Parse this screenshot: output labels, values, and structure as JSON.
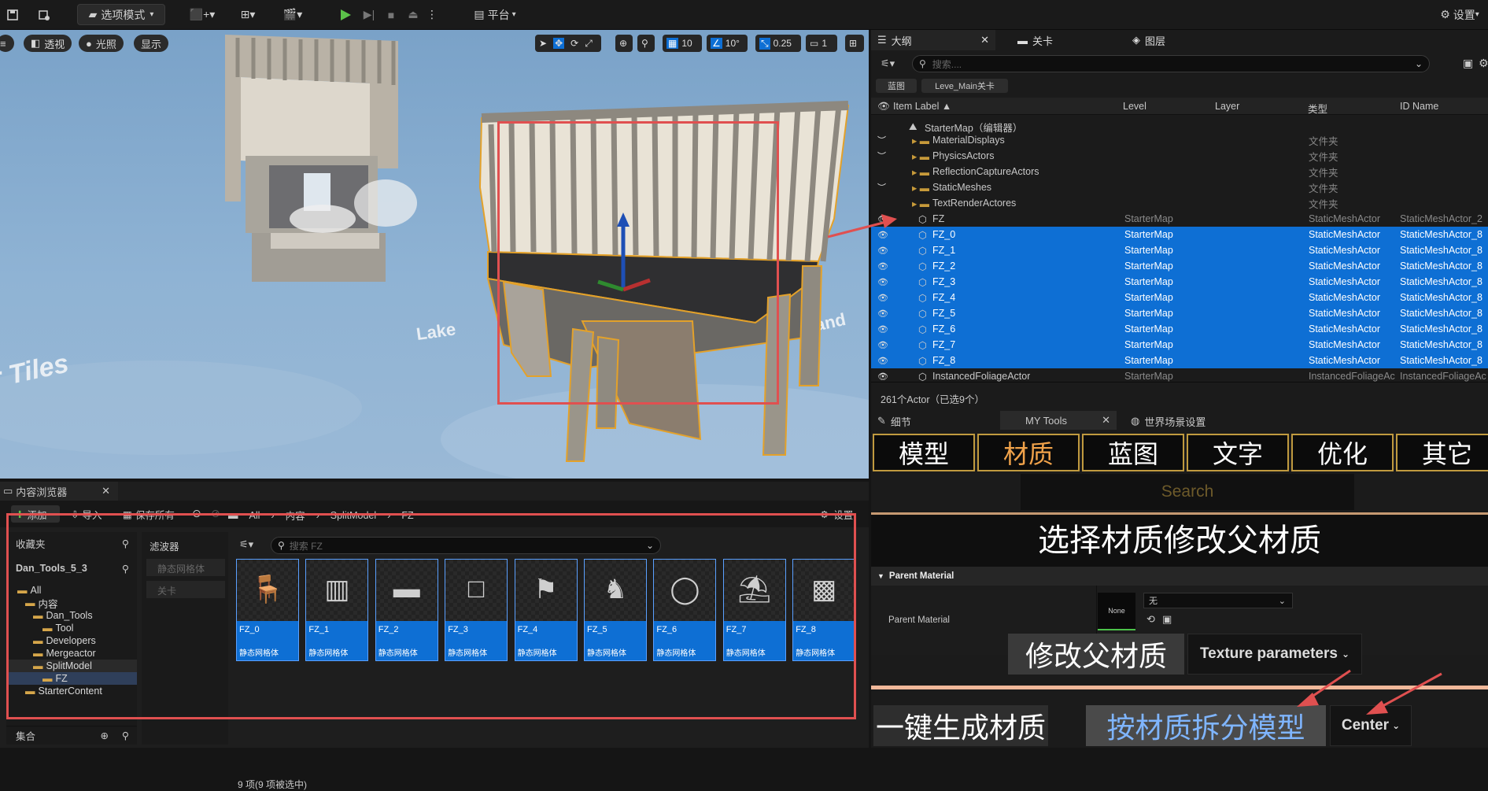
{
  "topbar": {
    "mode_label": "选项模式",
    "platform_label": "平台",
    "settings_label": "设置"
  },
  "viewport": {
    "perspective_label": "透视",
    "lighting_label": "光照",
    "show_label": "显示",
    "grid_snap": "10",
    "rotation_snap": "10°",
    "scale_snap": "0.25",
    "camera_speed": "1",
    "floor_text_1": "r Tiles",
    "floor_text_2": "Lake",
    "floor_text_3": "(and"
  },
  "outliner": {
    "tabs": [
      "大纲",
      "关卡",
      "图层"
    ],
    "search_placeholder": "搜索....",
    "filter_chips": [
      "蓝图",
      "Leve_Main关卡"
    ],
    "columns": [
      "Item Label ▲",
      "Level",
      "Layer",
      "类型",
      "ID Name"
    ],
    "root": "StarterMap（编辑器）",
    "rows": [
      {
        "label": "MaterialDisplays",
        "level": "",
        "type": "文件夹",
        "id": "",
        "folder": true,
        "selected": false
      },
      {
        "label": "PhysicsActors",
        "level": "",
        "type": "文件夹",
        "id": "",
        "folder": true,
        "selected": false
      },
      {
        "label": "ReflectionCaptureActors",
        "level": "",
        "type": "文件夹",
        "id": "",
        "folder": true,
        "selected": false
      },
      {
        "label": "StaticMeshes",
        "level": "",
        "type": "文件夹",
        "id": "",
        "folder": true,
        "selected": false
      },
      {
        "label": "TextRenderActores",
        "level": "",
        "type": "文件夹",
        "id": "",
        "folder": true,
        "selected": false
      },
      {
        "label": "FZ",
        "level": "StarterMap",
        "type": "StaticMeshActor",
        "id": "StaticMeshActor_2",
        "folder": false,
        "selected": false
      },
      {
        "label": "FZ_0",
        "level": "StarterMap",
        "type": "StaticMeshActor",
        "id": "StaticMeshActor_8",
        "folder": false,
        "selected": true
      },
      {
        "label": "FZ_1",
        "level": "StarterMap",
        "type": "StaticMeshActor",
        "id": "StaticMeshActor_8",
        "folder": false,
        "selected": true
      },
      {
        "label": "FZ_2",
        "level": "StarterMap",
        "type": "StaticMeshActor",
        "id": "StaticMeshActor_8",
        "folder": false,
        "selected": true
      },
      {
        "label": "FZ_3",
        "level": "StarterMap",
        "type": "StaticMeshActor",
        "id": "StaticMeshActor_8",
        "folder": false,
        "selected": true
      },
      {
        "label": "FZ_4",
        "level": "StarterMap",
        "type": "StaticMeshActor",
        "id": "StaticMeshActor_8",
        "folder": false,
        "selected": true
      },
      {
        "label": "FZ_5",
        "level": "StarterMap",
        "type": "StaticMeshActor",
        "id": "StaticMeshActor_8",
        "folder": false,
        "selected": true
      },
      {
        "label": "FZ_6",
        "level": "StarterMap",
        "type": "StaticMeshActor",
        "id": "StaticMeshActor_8",
        "folder": false,
        "selected": true
      },
      {
        "label": "FZ_7",
        "level": "StarterMap",
        "type": "StaticMeshActor",
        "id": "StaticMeshActor_8",
        "folder": false,
        "selected": true
      },
      {
        "label": "FZ_8",
        "level": "StarterMap",
        "type": "StaticMeshActor",
        "id": "StaticMeshActor_8",
        "folder": false,
        "selected": true
      },
      {
        "label": "InstancedFoliageActor",
        "level": "StarterMap",
        "type": "InstancedFoliageAc",
        "id": "InstancedFoliageAc",
        "folder": false,
        "selected": false
      }
    ],
    "status": "261个Actor（已选9个）"
  },
  "details": {
    "tabs": [
      "细节",
      "MY Tools",
      "世界场景设置"
    ],
    "tool_tabs": [
      "模型",
      "材质",
      "蓝图",
      "文字",
      "优化",
      "其它"
    ],
    "active_tool_tab": "材质",
    "search_label": "Search",
    "heading": "选择材质修改父材质",
    "section_title": "Parent Material",
    "property_label": "Parent Material",
    "thumb_label": "None",
    "dropdown_value": "无",
    "modify_button": "修改父材质",
    "texture_params": "Texture parameters",
    "generate_button": "一键生成材质",
    "split_button": "按材质拆分模型",
    "center_dropdown": "Center"
  },
  "content_browser": {
    "tab_title": "内容浏览器",
    "add_label": "添加",
    "import_label": "导入",
    "save_all_label": "保存所有",
    "breadcrumb": [
      "All",
      "内容",
      "SplitModel",
      "FZ"
    ],
    "settings_label": "设置",
    "favorites_label": "收藏夹",
    "project_label": "Dan_Tools_5_3",
    "filters_label": "滤波器",
    "filter_items": [
      "静态网格体",
      "关卡"
    ],
    "search_placeholder": "搜索 FZ",
    "tree": [
      "All",
      "内容",
      "Dan_Tools",
      "Tool",
      "Developers",
      "Mergeactor",
      "SplitModel",
      "FZ",
      "StarterContent"
    ],
    "collections_label": "集合",
    "assets": [
      {
        "name": "FZ_0",
        "type": "静态网格体"
      },
      {
        "name": "FZ_1",
        "type": "静态网格体"
      },
      {
        "name": "FZ_2",
        "type": "静态网格体"
      },
      {
        "name": "FZ_3",
        "type": "静态网格体"
      },
      {
        "name": "FZ_4",
        "type": "静态网格体"
      },
      {
        "name": "FZ_5",
        "type": "静态网格体"
      },
      {
        "name": "FZ_6",
        "type": "静态网格体"
      },
      {
        "name": "FZ_7",
        "type": "静态网格体"
      },
      {
        "name": "FZ_8",
        "type": "静态网格体"
      }
    ],
    "status": "9 项(9 项被选中)"
  },
  "colors": {
    "selection": "#0e6fd4",
    "annotation_red": "#e05050",
    "tool_tab_border": "#c09a3f",
    "active_tab_text": "#f0a24a"
  }
}
